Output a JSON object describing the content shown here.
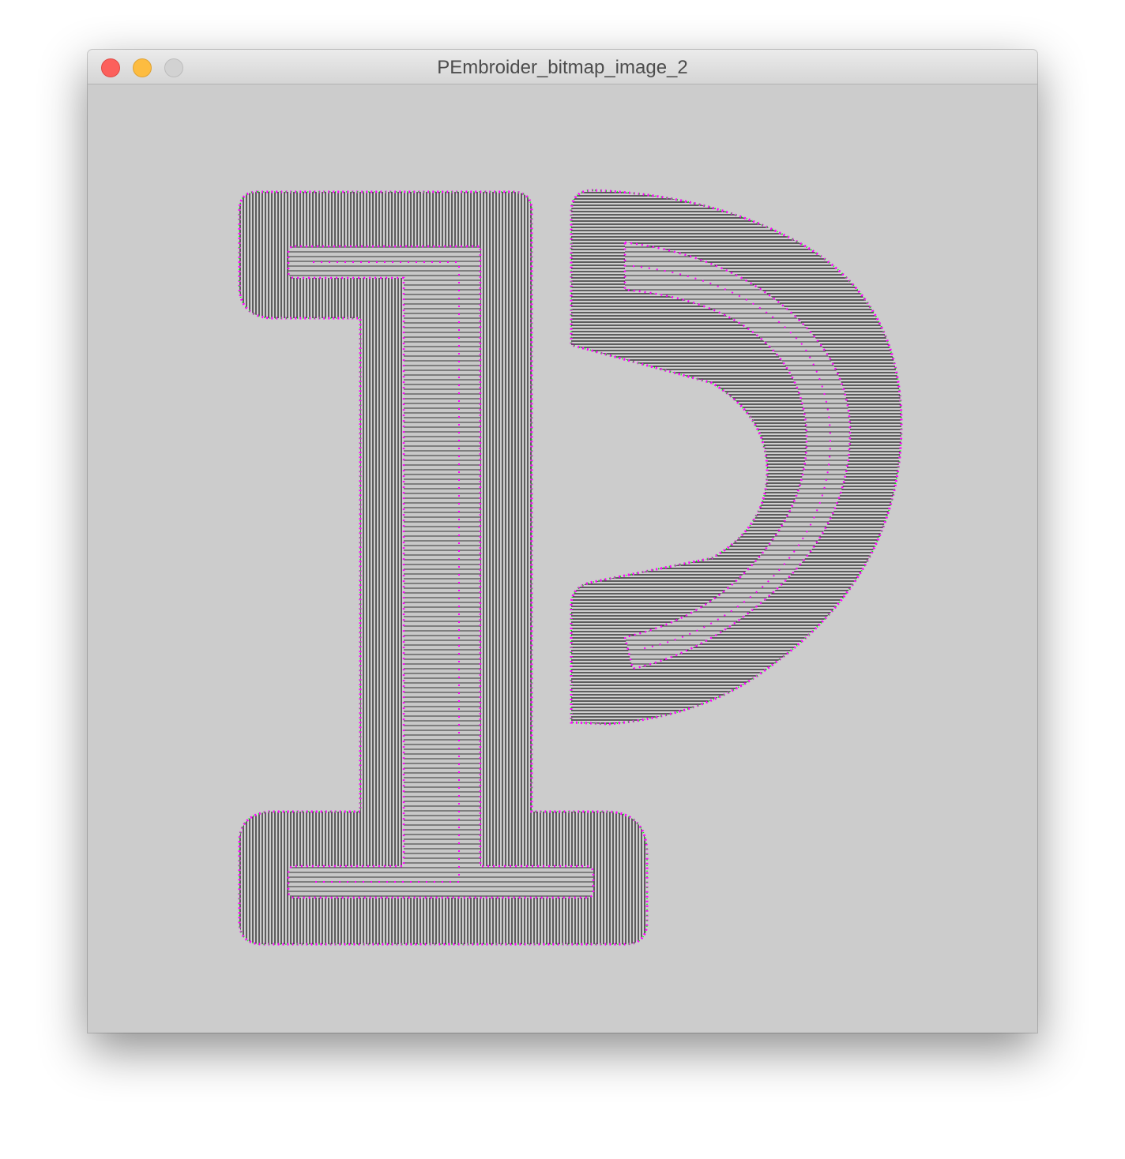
{
  "window": {
    "title": "PEmbroider_bitmap_image_2"
  },
  "controls": {
    "close": "close-button",
    "minimize": "minimize-button",
    "zoom": "zoom-button"
  },
  "canvas": {
    "background": "#cccccc",
    "stitch_color": "#000000",
    "needle_point_color": "#ff00ff",
    "endpoint_color": "#00ff00",
    "glyphs": [
      "1",
      "P"
    ]
  }
}
